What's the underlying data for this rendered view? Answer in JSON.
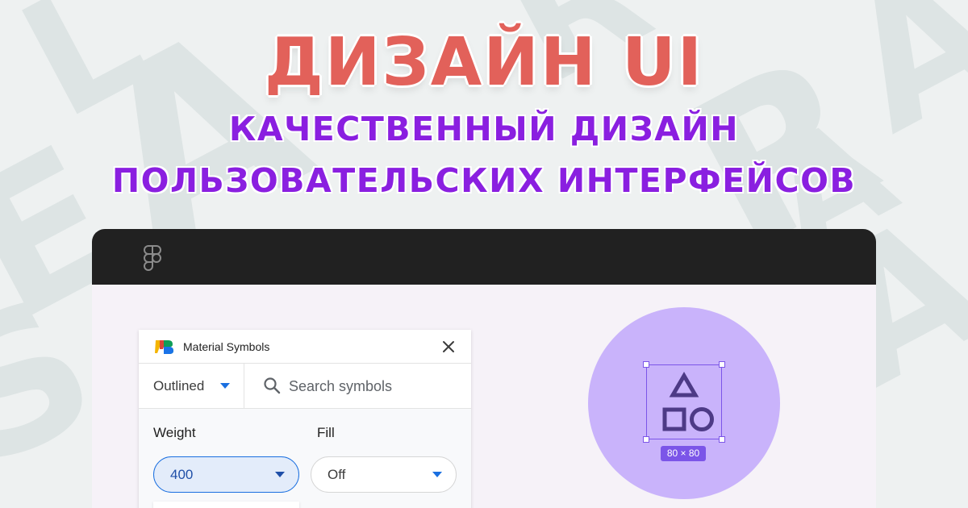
{
  "hero": {
    "title": "ДИЗАЙН UI",
    "subtitle_line1": "КАЧЕСТВЕННЫЙ ДИЗАЙН",
    "subtitle_line2": "ПОЛЬЗОВАТЕЛЬСКИХ ИНТЕРФЕЙСОВ"
  },
  "background": {
    "letters": [
      "A",
      "R",
      "E",
      "A",
      "L",
      "S",
      "A",
      "R",
      "A"
    ]
  },
  "app": {
    "logo_icon": "figma-logo-icon"
  },
  "plugin": {
    "title": "Material Symbols",
    "close_icon": "close-icon",
    "style_select": {
      "value": "Outlined"
    },
    "search": {
      "placeholder": "Search symbols",
      "value": ""
    },
    "weight": {
      "label": "Weight",
      "value": "400"
    },
    "fill": {
      "label": "Fill",
      "value": "Off"
    }
  },
  "preview": {
    "icon": "shapes-icon",
    "size_label": "80 × 80"
  },
  "colors": {
    "title": "#e2615a",
    "subtitle": "#8a1fe0",
    "titlebar": "#212121",
    "canvas": "#f6f2f8",
    "preview_circle": "#c9b3fb",
    "selection": "#7b55e8",
    "accent_blue": "#1a6fe0"
  }
}
